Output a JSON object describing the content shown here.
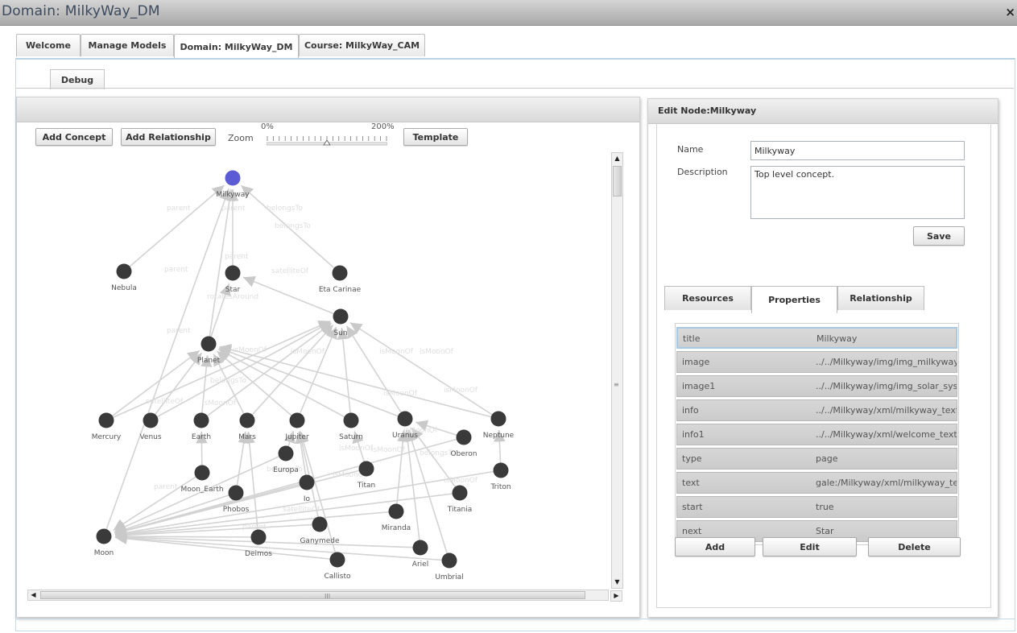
{
  "window": {
    "title": "Domain: MilkyWay_DM",
    "close_glyph": "×"
  },
  "tabs": [
    {
      "label": "Welcome"
    },
    {
      "label": "Manage Models"
    },
    {
      "label": "Domain: MilkyWay_DM",
      "active": true
    },
    {
      "label": "Course: MilkyWay_CAM"
    }
  ],
  "subtab": {
    "label": "Debug"
  },
  "toolbar": {
    "add_concept": "Add Concept",
    "add_relationship": "Add Relationship",
    "zoom_label": "Zoom",
    "zoom_min": "0%",
    "zoom_max": "200%",
    "zoom_level": 0.5,
    "template": "Template"
  },
  "scroll": {
    "h_grip": "III",
    "v_grip": "≡"
  },
  "graph": {
    "selected_color": "#5b5bd6",
    "node_color": "#3a3a3a",
    "nodes": [
      "Milkyway",
      "Nebula",
      "Star",
      "Eta Carinae",
      "Sun",
      "Planet",
      "Mercury",
      "Venus",
      "Earth",
      "Mars",
      "Jupiter",
      "Saturn",
      "Uranus",
      "Neptune",
      "Oberon",
      "Europa",
      "Moon_Earth",
      "Titan",
      "Triton",
      "Io",
      "Phobos",
      "Titania",
      "Miranda",
      "Ganymede",
      "Moon",
      "Deimos",
      "Ariel",
      "Callisto",
      "Umbrial"
    ],
    "edge_labels": [
      "parent",
      "belongsTo",
      "satelliteOf",
      "rotatesAround",
      "isMoonOf"
    ]
  },
  "editor": {
    "title": "Edit Node:Milkyway",
    "name_label": "Name",
    "name_value": "Milkyway",
    "description_label": "Description",
    "description_value": "Top level concept.",
    "save": "Save",
    "tabs": [
      {
        "label": "Resources"
      },
      {
        "label": "Properties",
        "active": true
      },
      {
        "label": "Relationship"
      }
    ],
    "properties": [
      {
        "key": "title",
        "value": "Milkyway"
      },
      {
        "key": "image",
        "value": "../../Milkyway/img/img_milkyway.jpg"
      },
      {
        "key": "image1",
        "value": "../../Milkyway/img/img_solar_system.jpg"
      },
      {
        "key": "info",
        "value": "../../Milkyway/xml/milkyway_text.xhtml"
      },
      {
        "key": "info1",
        "value": "../../Milkyway/xml/welcome_text.xhtml"
      },
      {
        "key": "type",
        "value": "page"
      },
      {
        "key": "text",
        "value": "gale:/Milkyway/xml/milkyway_text.xhtml"
      },
      {
        "key": "start",
        "value": "true"
      },
      {
        "key": "next",
        "value": "Star"
      }
    ],
    "add": "Add",
    "edit": "Edit",
    "delete": "Delete"
  }
}
